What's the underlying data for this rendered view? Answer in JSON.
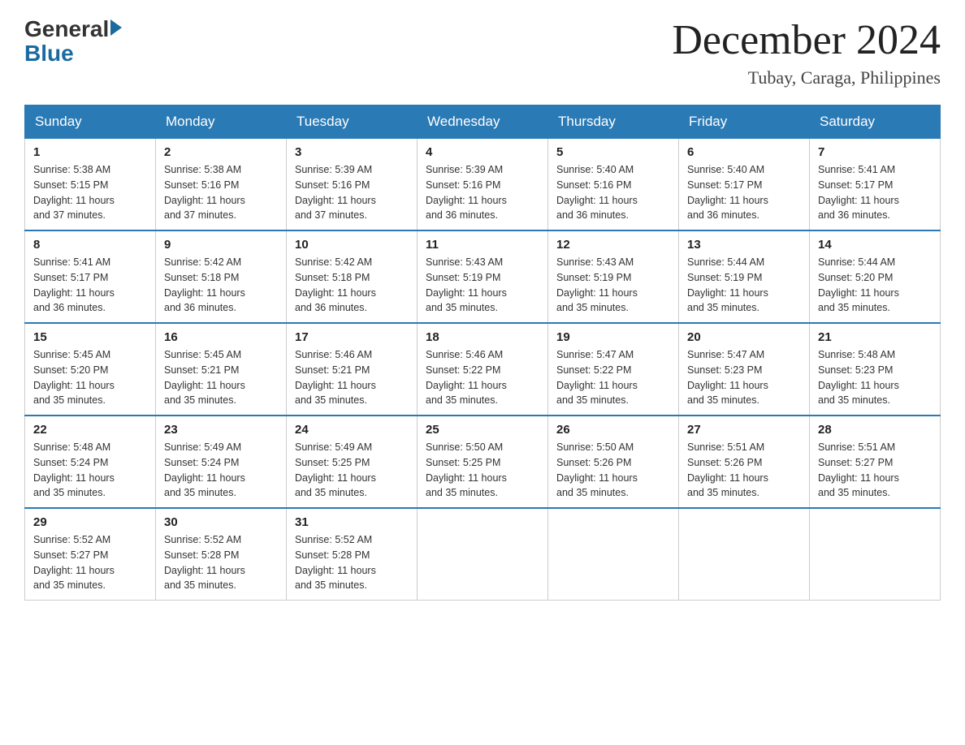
{
  "logo": {
    "general": "General",
    "blue": "Blue"
  },
  "title": {
    "month": "December 2024",
    "location": "Tubay, Caraga, Philippines"
  },
  "headers": [
    "Sunday",
    "Monday",
    "Tuesday",
    "Wednesday",
    "Thursday",
    "Friday",
    "Saturday"
  ],
  "weeks": [
    [
      {
        "day": "1",
        "sunrise": "5:38 AM",
        "sunset": "5:15 PM",
        "daylight": "11 hours and 37 minutes."
      },
      {
        "day": "2",
        "sunrise": "5:38 AM",
        "sunset": "5:16 PM",
        "daylight": "11 hours and 37 minutes."
      },
      {
        "day": "3",
        "sunrise": "5:39 AM",
        "sunset": "5:16 PM",
        "daylight": "11 hours and 37 minutes."
      },
      {
        "day": "4",
        "sunrise": "5:39 AM",
        "sunset": "5:16 PM",
        "daylight": "11 hours and 36 minutes."
      },
      {
        "day": "5",
        "sunrise": "5:40 AM",
        "sunset": "5:16 PM",
        "daylight": "11 hours and 36 minutes."
      },
      {
        "day": "6",
        "sunrise": "5:40 AM",
        "sunset": "5:17 PM",
        "daylight": "11 hours and 36 minutes."
      },
      {
        "day": "7",
        "sunrise": "5:41 AM",
        "sunset": "5:17 PM",
        "daylight": "11 hours and 36 minutes."
      }
    ],
    [
      {
        "day": "8",
        "sunrise": "5:41 AM",
        "sunset": "5:17 PM",
        "daylight": "11 hours and 36 minutes."
      },
      {
        "day": "9",
        "sunrise": "5:42 AM",
        "sunset": "5:18 PM",
        "daylight": "11 hours and 36 minutes."
      },
      {
        "day": "10",
        "sunrise": "5:42 AM",
        "sunset": "5:18 PM",
        "daylight": "11 hours and 36 minutes."
      },
      {
        "day": "11",
        "sunrise": "5:43 AM",
        "sunset": "5:19 PM",
        "daylight": "11 hours and 35 minutes."
      },
      {
        "day": "12",
        "sunrise": "5:43 AM",
        "sunset": "5:19 PM",
        "daylight": "11 hours and 35 minutes."
      },
      {
        "day": "13",
        "sunrise": "5:44 AM",
        "sunset": "5:19 PM",
        "daylight": "11 hours and 35 minutes."
      },
      {
        "day": "14",
        "sunrise": "5:44 AM",
        "sunset": "5:20 PM",
        "daylight": "11 hours and 35 minutes."
      }
    ],
    [
      {
        "day": "15",
        "sunrise": "5:45 AM",
        "sunset": "5:20 PM",
        "daylight": "11 hours and 35 minutes."
      },
      {
        "day": "16",
        "sunrise": "5:45 AM",
        "sunset": "5:21 PM",
        "daylight": "11 hours and 35 minutes."
      },
      {
        "day": "17",
        "sunrise": "5:46 AM",
        "sunset": "5:21 PM",
        "daylight": "11 hours and 35 minutes."
      },
      {
        "day": "18",
        "sunrise": "5:46 AM",
        "sunset": "5:22 PM",
        "daylight": "11 hours and 35 minutes."
      },
      {
        "day": "19",
        "sunrise": "5:47 AM",
        "sunset": "5:22 PM",
        "daylight": "11 hours and 35 minutes."
      },
      {
        "day": "20",
        "sunrise": "5:47 AM",
        "sunset": "5:23 PM",
        "daylight": "11 hours and 35 minutes."
      },
      {
        "day": "21",
        "sunrise": "5:48 AM",
        "sunset": "5:23 PM",
        "daylight": "11 hours and 35 minutes."
      }
    ],
    [
      {
        "day": "22",
        "sunrise": "5:48 AM",
        "sunset": "5:24 PM",
        "daylight": "11 hours and 35 minutes."
      },
      {
        "day": "23",
        "sunrise": "5:49 AM",
        "sunset": "5:24 PM",
        "daylight": "11 hours and 35 minutes."
      },
      {
        "day": "24",
        "sunrise": "5:49 AM",
        "sunset": "5:25 PM",
        "daylight": "11 hours and 35 minutes."
      },
      {
        "day": "25",
        "sunrise": "5:50 AM",
        "sunset": "5:25 PM",
        "daylight": "11 hours and 35 minutes."
      },
      {
        "day": "26",
        "sunrise": "5:50 AM",
        "sunset": "5:26 PM",
        "daylight": "11 hours and 35 minutes."
      },
      {
        "day": "27",
        "sunrise": "5:51 AM",
        "sunset": "5:26 PM",
        "daylight": "11 hours and 35 minutes."
      },
      {
        "day": "28",
        "sunrise": "5:51 AM",
        "sunset": "5:27 PM",
        "daylight": "11 hours and 35 minutes."
      }
    ],
    [
      {
        "day": "29",
        "sunrise": "5:52 AM",
        "sunset": "5:27 PM",
        "daylight": "11 hours and 35 minutes."
      },
      {
        "day": "30",
        "sunrise": "5:52 AM",
        "sunset": "5:28 PM",
        "daylight": "11 hours and 35 minutes."
      },
      {
        "day": "31",
        "sunrise": "5:52 AM",
        "sunset": "5:28 PM",
        "daylight": "11 hours and 35 minutes."
      },
      null,
      null,
      null,
      null
    ]
  ],
  "labels": {
    "sunrise": "Sunrise:",
    "sunset": "Sunset:",
    "daylight": "Daylight:"
  }
}
